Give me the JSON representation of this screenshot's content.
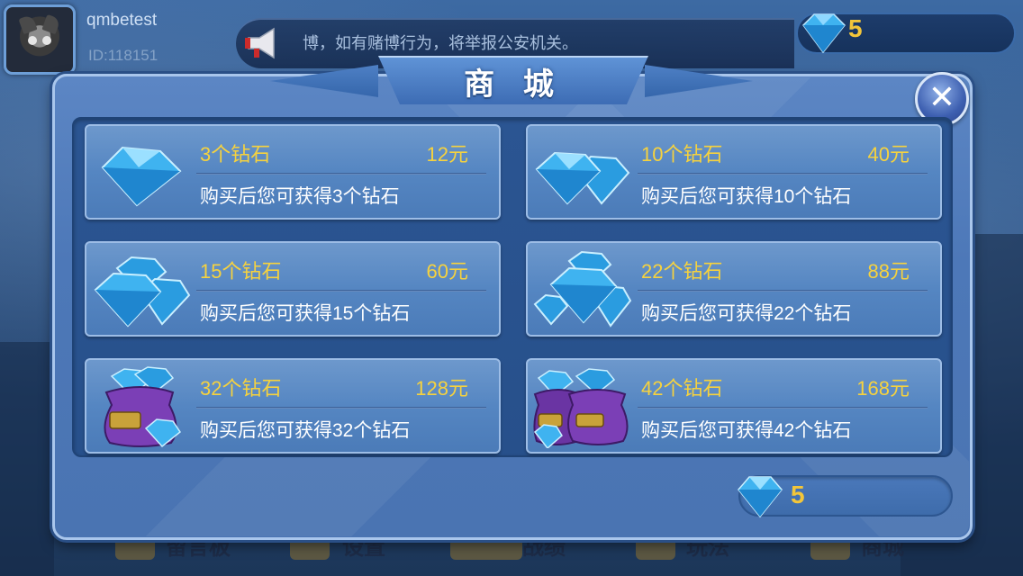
{
  "user": {
    "name": "qmbetest",
    "id": "ID:118151"
  },
  "marquee": {
    "text": "博，如有赌博行为，将举报公安机关。"
  },
  "top_bar": {
    "diamond_count": "5"
  },
  "bottom_nav": {
    "items": [
      "留言板",
      "设置",
      "战绩",
      "玩法",
      "商城"
    ]
  },
  "shop": {
    "title": "商 城",
    "close_label": "✕",
    "balance": "5",
    "items": [
      {
        "name": "3个钻石",
        "price": "12元",
        "desc": "购买后您可获得3个钻石",
        "icon": "diamond-single-icon"
      },
      {
        "name": "10个钻石",
        "price": "40元",
        "desc": "购买后您可获得10个钻石",
        "icon": "diamond-pair-icon"
      },
      {
        "name": "15个钻石",
        "price": "60元",
        "desc": "购买后您可获得15个钻石",
        "icon": "diamond-group-icon"
      },
      {
        "name": "22个钻石",
        "price": "88元",
        "desc": "购买后您可获得22个钻石",
        "icon": "diamond-pile-icon"
      },
      {
        "name": "32个钻石",
        "price": "128元",
        "desc": "购买后您可获得32个钻石",
        "icon": "diamond-bag-icon"
      },
      {
        "name": "42个钻石",
        "price": "168元",
        "desc": "购买后您可获得42个钻石",
        "icon": "diamond-bags-icon"
      }
    ]
  },
  "colors": {
    "gold_text": "#f6d23e",
    "panel_blue": "#27508b",
    "card_blue": "#5586c2",
    "diamond": "#3fb3f0",
    "bag_purple": "#7b3fb6"
  }
}
